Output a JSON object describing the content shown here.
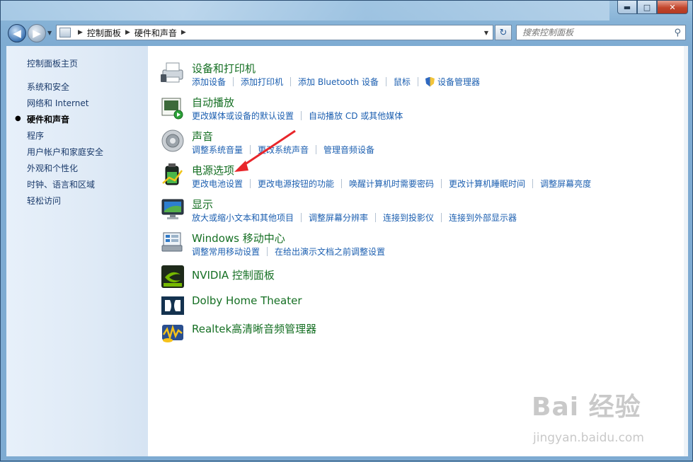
{
  "window": {
    "caption": {
      "minimize": "▬",
      "maximize": "□",
      "close": "✕"
    }
  },
  "nav": {
    "back": "◀",
    "forward": "▶",
    "dropdown": "▼"
  },
  "address": {
    "separator": "▶",
    "crumbs": [
      "控制面板",
      "硬件和声音"
    ],
    "dropdown": "▼",
    "refresh": "↻"
  },
  "search": {
    "placeholder": "搜索控制面板",
    "icon": "search-icon",
    "glyph": "⚲"
  },
  "sidebar": {
    "bullet": "●",
    "items": [
      {
        "label": "控制面板主页"
      },
      {
        "label": "系统和安全"
      },
      {
        "label": "网络和 Internet"
      },
      {
        "label": "硬件和声音",
        "active": true
      },
      {
        "label": "程序"
      },
      {
        "label": "用户帐户和家庭安全"
      },
      {
        "label": "外观和个性化"
      },
      {
        "label": "时钟、语言和区域"
      },
      {
        "label": "轻松访问"
      }
    ]
  },
  "categories": [
    {
      "title": "设备和打印机",
      "icon": "printer-icon",
      "links": [
        "添加设备",
        "添加打印机",
        "添加 Bluetooth 设备",
        "鼠标",
        "设备管理器"
      ]
    },
    {
      "title": "自动播放",
      "icon": "autoplay-icon",
      "links": [
        "更改媒体或设备的默认设置",
        "自动播放 CD 或其他媒体"
      ]
    },
    {
      "title": "声音",
      "icon": "speaker-icon",
      "links": [
        "调整系统音量",
        "更改系统声音",
        "管理音频设备"
      ]
    },
    {
      "title": "电源选项",
      "icon": "battery-icon",
      "links": [
        "更改电池设置",
        "更改电源按钮的功能",
        "唤醒计算机时需要密码",
        "更改计算机睡眠时间",
        "调整屏幕亮度"
      ]
    },
    {
      "title": "显示",
      "icon": "monitor-icon",
      "links": [
        "放大或缩小文本和其他项目",
        "调整屏幕分辨率",
        "连接到投影仪",
        "连接到外部显示器"
      ]
    },
    {
      "title": "Windows 移动中心",
      "icon": "mobility-center-icon",
      "links": [
        "调整常用移动设置",
        "在给出演示文档之前调整设置"
      ]
    },
    {
      "title": "NVIDIA 控制面板",
      "icon": "nvidia-icon",
      "links": []
    },
    {
      "title": "Dolby Home Theater",
      "icon": "dolby-icon",
      "links": []
    },
    {
      "title": "Realtek高清晰音频管理器",
      "icon": "realtek-icon",
      "links": []
    }
  ],
  "watermark": {
    "brand": "Bai 经验",
    "url": "jingyan.baidu.com"
  },
  "colors": {
    "title_green": "#156f23",
    "link_blue": "#1c5fb0",
    "annotation_red": "#e8262b"
  }
}
